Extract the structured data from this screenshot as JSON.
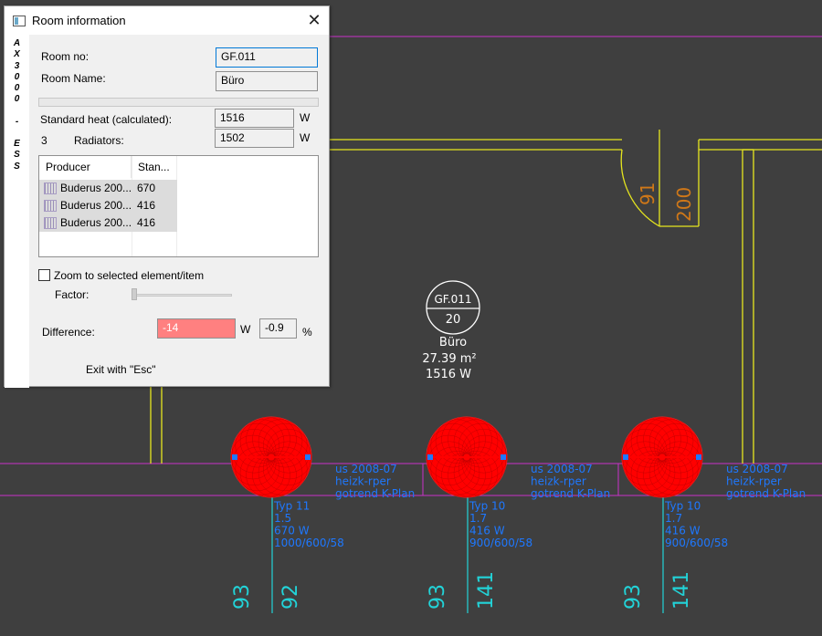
{
  "dialog": {
    "title": "Room information",
    "close_glyph": "✕",
    "brand_letters": [
      "A",
      "X",
      "3",
      "0",
      "0",
      "0",
      "-",
      "E",
      "S",
      "S"
    ],
    "room_no_label": "Room no:",
    "room_no_value": "GF.011",
    "room_name_label": "Room Name:",
    "room_name_value": "Büro",
    "standard_heat_label": "Standard heat (calculated):",
    "standard_heat_value": "1516",
    "standard_heat_unit": "W",
    "radiator_count": "3",
    "radiators_label": "Radiators:",
    "radiators_value": "1502",
    "radiators_unit": "W",
    "list": {
      "columns": [
        "Producer",
        "Stan..."
      ],
      "rows": [
        {
          "producer": "Buderus 200...",
          "standard": "670"
        },
        {
          "producer": "Buderus 200...",
          "standard": "416"
        },
        {
          "producer": "Buderus 200...",
          "standard": "416"
        }
      ]
    },
    "zoom_label": "Zoom to selected element/item",
    "zoom_checked": false,
    "factor_label": "Factor:",
    "factor_level": 0,
    "difference_label": "Difference:",
    "difference_w": "-14",
    "difference_w_unit": "W",
    "difference_pct": "-0.9",
    "difference_pct_unit": "%",
    "exit_hint": "Exit with \"Esc\""
  },
  "drawing": {
    "room_tag": {
      "number": "GF.011",
      "height": "20",
      "name": "Büro",
      "area": "27.39 m²",
      "heat": "1516 W"
    },
    "door": {
      "width": "91",
      "height": "200"
    },
    "radiators": [
      {
        "label_lines": [
          "us 2008-07",
          "heizk-rper",
          "gotrend K-Plan",
          "Typ 11",
          "1.5",
          "670  W",
          "1000/600/58"
        ],
        "dim_a": "93",
        "dim_b": "92"
      },
      {
        "label_lines": [
          "us 2008-07",
          "heizk-rper",
          "gotrend K-Plan",
          "Typ 10",
          "1.7",
          "416  W",
          "900/600/58"
        ],
        "dim_a": "93",
        "dim_b": "141"
      },
      {
        "label_lines": [
          "us 2008-07",
          "heizk-rper",
          "gotrend K-Plan",
          "Typ 10",
          "1.7",
          "416  W",
          "900/600/58"
        ],
        "dim_a": "93",
        "dim_b": "141"
      }
    ],
    "colors": {
      "background": "#3f3f3f",
      "wall": "#e6e61e",
      "guide": "#c832c8",
      "radiator": "#ff0000",
      "annotation": "#1e78ff",
      "dimension": "#22d3d8",
      "door_text": "#d07818",
      "tag": "#ffffff"
    }
  }
}
